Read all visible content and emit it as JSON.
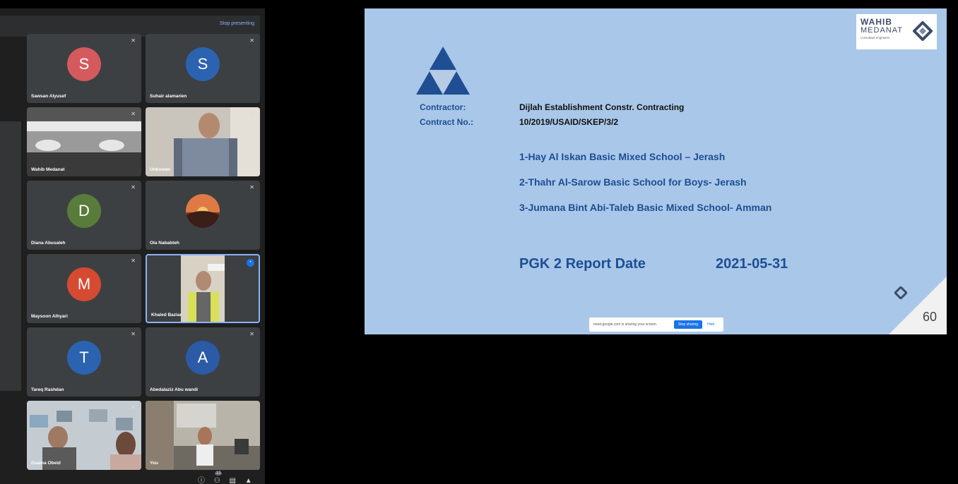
{
  "toolbar": {
    "stop_presenting": "Stop presenting"
  },
  "participants": [
    {
      "name": "Sawsan Alyusef",
      "initial": "S",
      "color": "#d55a5d",
      "muted": true
    },
    {
      "name": "Suhair alamarien",
      "initial": "S",
      "color": "#2b63b1",
      "muted": true
    },
    {
      "name": "Wahib Medanat",
      "muted": true,
      "video": true
    },
    {
      "name": "Unknown",
      "muted": true,
      "video": true
    },
    {
      "name": "Diana Abusaleh",
      "initial": "D",
      "color": "#5a7c3b",
      "muted": true
    },
    {
      "name": "Ola Nababteh",
      "muted": true
    },
    {
      "name": "Maysoon Alhyari",
      "initial": "M",
      "color": "#d64a32",
      "muted": true
    },
    {
      "name": "Khaled Baziar",
      "video": true,
      "speaking": true
    },
    {
      "name": "Tareq Rashdan",
      "initial": "T",
      "color": "#2b63b1",
      "muted": true
    },
    {
      "name": "Abedalaziz Abu wandi",
      "initial": "A",
      "color": "#2b5aa6",
      "muted": true
    },
    {
      "name": "Osama Obeid",
      "muted": true,
      "video": true
    },
    {
      "name": "You",
      "video": true
    }
  ],
  "icons": {
    "mic_off": "mic-off-icon",
    "speaking": "speaking-icon",
    "bottom": [
      "info-icon",
      "people-icon",
      "chat-icon",
      "activities-icon"
    ],
    "participant_count": "13"
  },
  "slide": {
    "logo": {
      "line1": "WAHIB",
      "line2": "MEDANAT",
      "line3": "consultant engineers"
    },
    "contractor_label": "Contractor:",
    "contractor_value": "Dijlah Establishment Constr. Contracting",
    "contract_no_label": "Contract No.:",
    "contract_no_value": "10/2019/USAID/SKEP/3/2",
    "schools": [
      "1-Hay Al Iskan Basic Mixed School – Jerash",
      "2-Thahr Al-Sarow Basic School for Boys- Jerash",
      "3-Jumana Bint Abi-Taleb Basic Mixed School- Amman"
    ],
    "report_label": "PGK 2 Report Date",
    "report_date": "2021-05-31",
    "page_number": "60"
  },
  "share_bar": {
    "text": "meet.google.com is sharing your screen.",
    "stop": "Stop sharing",
    "hide": "Hide"
  },
  "colors": {
    "slide_bg": "#a9c7e8",
    "slide_text": "#1c4e94",
    "accent": "#8ab4f8"
  }
}
